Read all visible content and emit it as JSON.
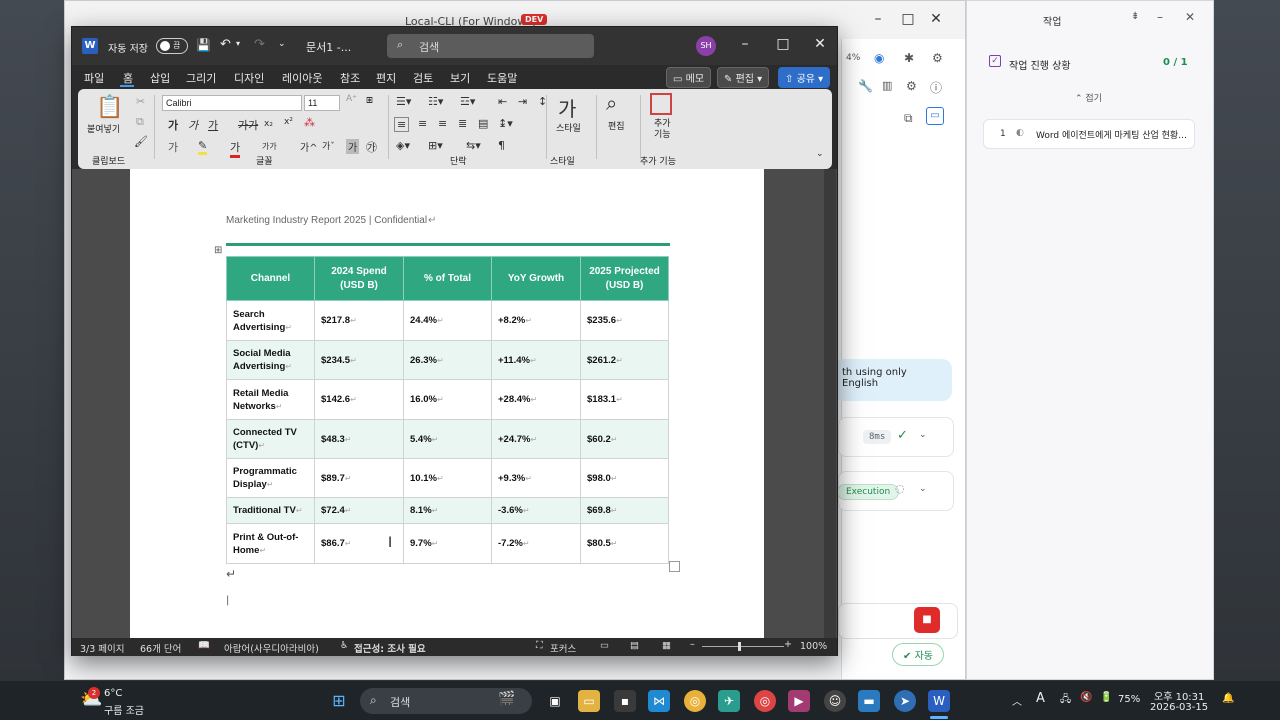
{
  "background_windows": {
    "cli": {
      "title": "Local-CLI (For Windows)",
      "badge": "DEV",
      "right_col": {
        "zoom": "4%"
      },
      "chat_bubble": "th using only English",
      "step1": {
        "duration": "8ms"
      },
      "step2": {
        "status": "Execution"
      },
      "auto_label": "자동"
    },
    "task_panel": {
      "title": "작업",
      "progress_label": "작업 진행 상황",
      "progress_value": "0 / 1",
      "fold_label": "접기",
      "item": {
        "number": "1",
        "text": "Word 에이전트에게 마케팅 산업 현황..."
      }
    }
  },
  "word": {
    "autosave_label": "자동 저장",
    "autosave_state": "끔",
    "doc_name": "문서1  -...",
    "search_placeholder": "검색",
    "avatar_initials": "SH",
    "menu": [
      "파일",
      "홈",
      "삽입",
      "그리기",
      "디자인",
      "레이아웃",
      "참조",
      "편지",
      "검토",
      "보기",
      "도움말"
    ],
    "comment_btn": "메모",
    "edit_btn": "편집",
    "share_btn": "공유",
    "ribbon": {
      "clipboard_group": "클립보드",
      "paste_label": "붙여넣기",
      "font_group": "글꼴",
      "font_name": "Calibri",
      "font_size": "11",
      "paragraph_group": "단락",
      "styles_group": "스타일",
      "styles_label": "스타일",
      "editing_label": "편집",
      "addins_label": "추가 기능",
      "addins_group": "추가 기능"
    },
    "document": {
      "header": "Marketing Industry Report 2025 | Confidential",
      "table": {
        "headers": [
          "Channel",
          "2024 Spend (USD B)",
          "% of Total",
          "YoY Growth",
          "2025 Projected (USD B)"
        ],
        "rows": [
          [
            "Search Advertising",
            "$217.8",
            "24.4%",
            "+8.2%",
            "$235.6"
          ],
          [
            "Social Media Advertising",
            "$234.5",
            "26.3%",
            "+11.4%",
            "$261.2"
          ],
          [
            "Retail Media Networks",
            "$142.6",
            "16.0%",
            "+28.4%",
            "$183.1"
          ],
          [
            "Connected TV (CTV)",
            "$48.3",
            "5.4%",
            "+24.7%",
            "$60.2"
          ],
          [
            "Programmatic Display",
            "$89.7",
            "10.1%",
            "+9.3%",
            "$98.0"
          ],
          [
            "Traditional TV",
            "$72.4",
            "8.1%",
            "-3.6%",
            "$69.8"
          ],
          [
            "Print & Out-of-Home",
            "$86.7",
            "9.7%",
            "-7.2%",
            "$80.5"
          ]
        ]
      }
    },
    "status": {
      "page": "3/3 페이지",
      "words": "66개 단어",
      "language": "아랍어(사우디아라비아)",
      "accessibility": "접근성: 조사 필요",
      "focus": "포커스",
      "zoom": "100%"
    }
  },
  "taskbar": {
    "weather_temp": "6°C",
    "weather_desc": "구름 조금",
    "weather_badge": "2",
    "search_label": "검색",
    "battery": "75%",
    "time": "오후 10:31",
    "date": "2026-03-15"
  },
  "colors": {
    "table_header": "#2fa882",
    "table_stripe": "#eaf6f2",
    "accent_blue": "#2e6ec9",
    "dev_badge": "#d9302c"
  }
}
